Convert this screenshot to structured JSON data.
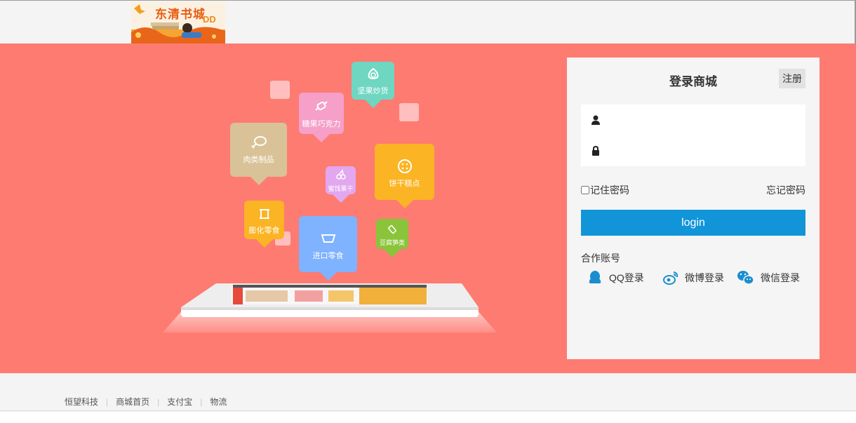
{
  "header": {
    "logo_name": "东清书城",
    "logo_sub": "DD"
  },
  "banner": {
    "background": "#fe7b72",
    "categories": [
      {
        "label": "坚果炒货",
        "color": "#6fd6c2",
        "icon": "nut-icon"
      },
      {
        "label": "糖果巧克力",
        "color": "#f59fc9",
        "icon": "candy-icon"
      },
      {
        "label": "肉类制品",
        "color": "#d9c297",
        "icon": "meat-icon"
      },
      {
        "label": "蜜饯果干",
        "color": "#e3a7f0",
        "icon": "cherry-icon"
      },
      {
        "label": "饼干糕点",
        "color": "#fbb424",
        "icon": "cookie-icon"
      },
      {
        "label": "膨化零食",
        "color": "#fbb424",
        "icon": "puffed-icon"
      },
      {
        "label": "进口零食",
        "color": "#7fb2ff",
        "icon": "import-icon"
      },
      {
        "label": "豆腐笋类",
        "color": "#8ac43b",
        "icon": "tofu-icon"
      }
    ]
  },
  "login": {
    "title": "登录商城",
    "register_label": "注册",
    "username_icon": "user-icon",
    "username_value": "",
    "password_icon": "lock-icon",
    "password_value": "",
    "remember_label": "记住密码",
    "forgot_label": "忘记密码",
    "login_label": "login",
    "login_color": "#1195d8",
    "partner_label": "合作账号",
    "oauth": [
      {
        "label": "QQ登录",
        "icon": "qq-icon"
      },
      {
        "label": "微博登录",
        "icon": "weibo-icon"
      },
      {
        "label": "微信登录",
        "icon": "wechat-icon"
      }
    ]
  },
  "footer": {
    "links": [
      "恒望科技",
      "商城首页",
      "支付宝",
      "物流"
    ]
  }
}
